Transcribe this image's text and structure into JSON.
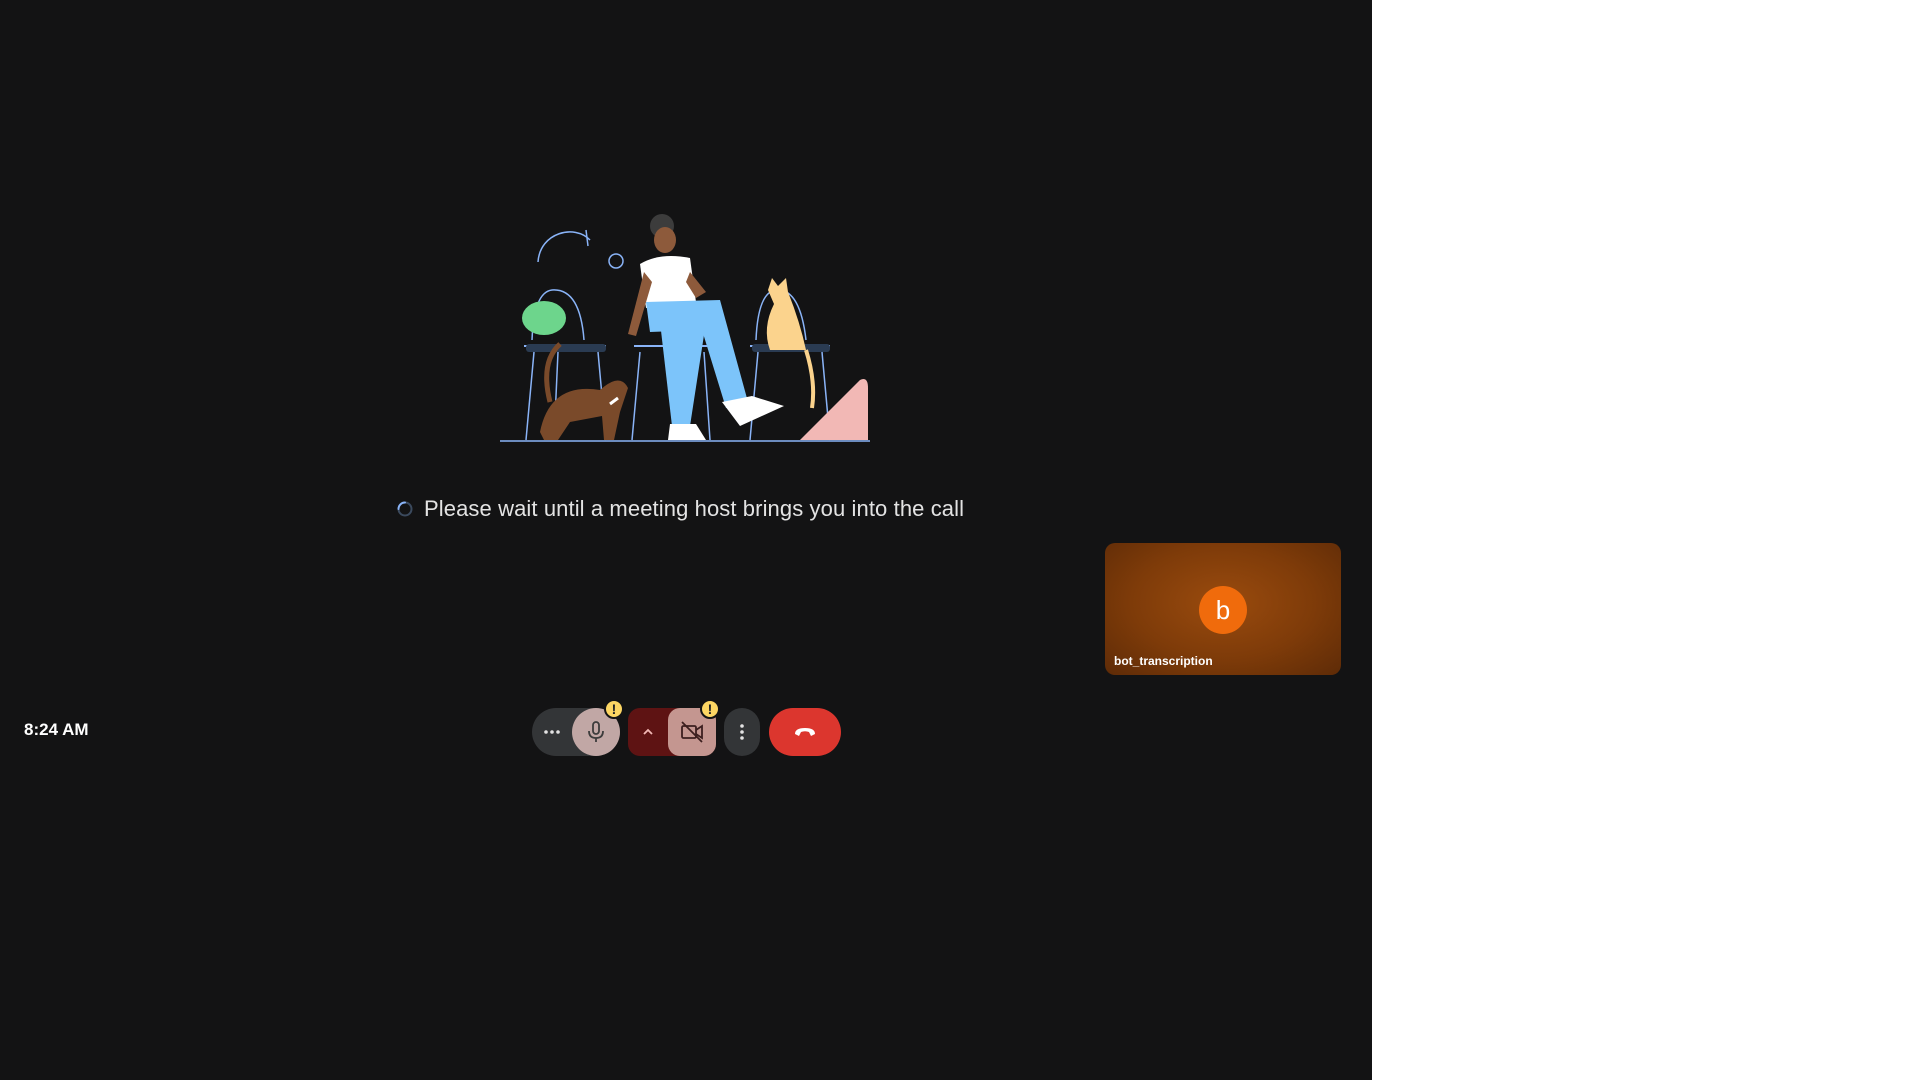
{
  "waiting": {
    "message": "Please wait until a meeting host brings you into the call"
  },
  "self_tile": {
    "avatar_letter": "b",
    "name": "bot_transcription"
  },
  "clock": {
    "time": "8:24 AM"
  },
  "controls": {
    "mic_more_icon": "more-horizontal-icon",
    "mic_icon": "microphone-icon",
    "mic_warning": "!",
    "cam_more_icon": "chevron-up-icon",
    "cam_icon": "video-off-icon",
    "cam_warning": "!",
    "more_options_icon": "more-vertical-icon",
    "leave_icon": "phone-hangup-icon"
  },
  "colors": {
    "background": "#131314",
    "leave_button": "#dc362e",
    "avatar": "#f06b0c",
    "warning": "#fdd663"
  }
}
